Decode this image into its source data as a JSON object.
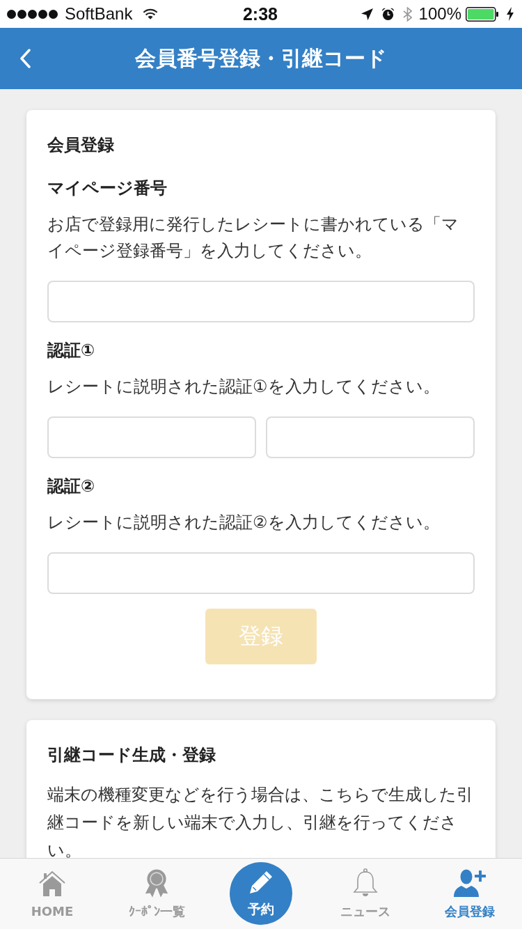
{
  "status_bar": {
    "carrier": "SoftBank",
    "time": "2:38",
    "battery": "100%"
  },
  "nav_bar": {
    "title": "会員番号登録・引継コード"
  },
  "member_card": {
    "title": "会員登録",
    "sections": [
      {
        "kind": "single",
        "label": "マイページ番号",
        "description": "お店で登録用に発行したレシートに書かれている「マイページ登録番号」を入力してください。"
      },
      {
        "kind": "pair",
        "label": "認証①",
        "description": "レシートに説明された認証①を入力してください。"
      },
      {
        "kind": "single",
        "label": "認証②",
        "description": "レシートに説明された認証②を入力してください。"
      }
    ],
    "button": {
      "label": "登録",
      "disabled": true
    }
  },
  "transfer_card": {
    "title": "引継コード生成・登録",
    "description": "端末の機種変更などを行う場合は、こちらで生成した引継コードを新しい端末で入力し、引継を行ってください。"
  },
  "tab_bar": {
    "items": [
      {
        "kind": "tab",
        "label": "HOME",
        "selected": false
      },
      {
        "kind": "tab",
        "label": "ｸｰﾎﾟﾝ一覧",
        "selected": false
      },
      {
        "kind": "center",
        "label": "予約",
        "selected": false
      },
      {
        "kind": "tab",
        "label": "ニュース",
        "selected": false
      },
      {
        "kind": "tab",
        "label": "会員登録",
        "selected": true
      }
    ]
  }
}
